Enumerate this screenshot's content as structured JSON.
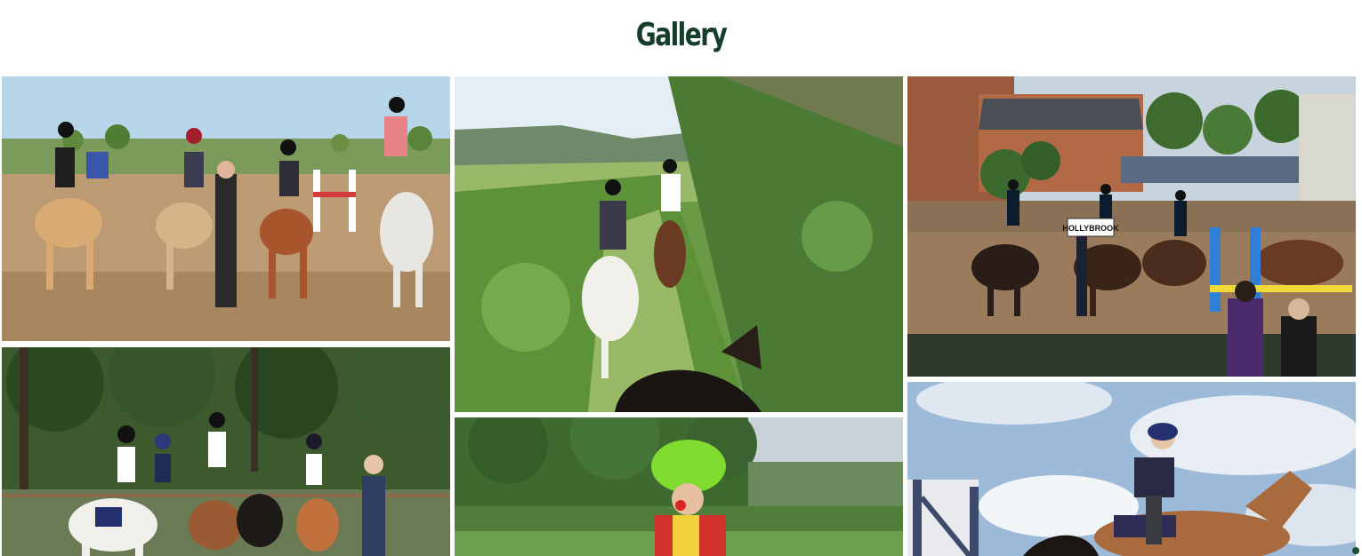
{
  "page": {
    "title": "Gallery",
    "title_color": "#163d2b"
  },
  "gallery": {
    "photos": [
      {
        "subject": "riders-on-ponies-in-arena"
      },
      {
        "subject": "kids-with-instructor-and-ponies"
      },
      {
        "subject": "trail-ride-through-ferns"
      },
      {
        "subject": "clown-at-show"
      },
      {
        "subject": "show-jumping-parade-hollybrook"
      },
      {
        "subject": "rider-jumping-fence"
      }
    ],
    "sign_text": "HOLLYBROOK"
  }
}
